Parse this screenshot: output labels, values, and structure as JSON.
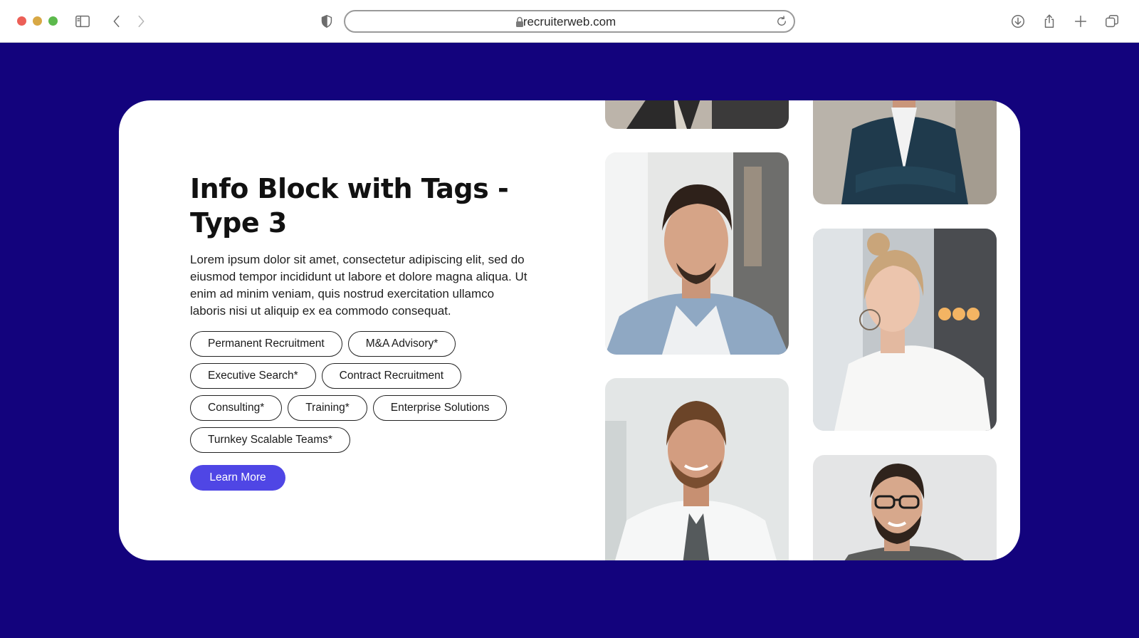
{
  "browser": {
    "url": "recruiterweb.com",
    "icons": [
      "sidebar-icon",
      "back-icon",
      "forward-icon",
      "shield-icon",
      "lock-icon",
      "reload-icon",
      "download-icon",
      "share-icon",
      "new-tab-icon",
      "tabs-overview-icon"
    ]
  },
  "hero": {
    "title": "Info Block with Tags - Type 3",
    "description": "Lorem ipsum dolor sit amet, consectetur adipiscing elit, sed do eiusmod tempor incididunt ut labore et dolore magna aliqua. Ut enim ad minim veniam, quis nostrud exercitation ullamco laboris nisi ut aliquip ex ea commodo consequat.",
    "tags": [
      "Permanent Recruitment",
      "M&A Advisory*",
      "Executive Search*",
      "Contract Recruitment",
      "Consulting*",
      "Training*",
      "Enterprise Solutions",
      "Turnkey Scalable Teams*"
    ],
    "cta_label": "Learn More"
  },
  "colors": {
    "page_background": "#13037d",
    "card_background": "#ffffff",
    "cta_background": "#4f46e5"
  }
}
